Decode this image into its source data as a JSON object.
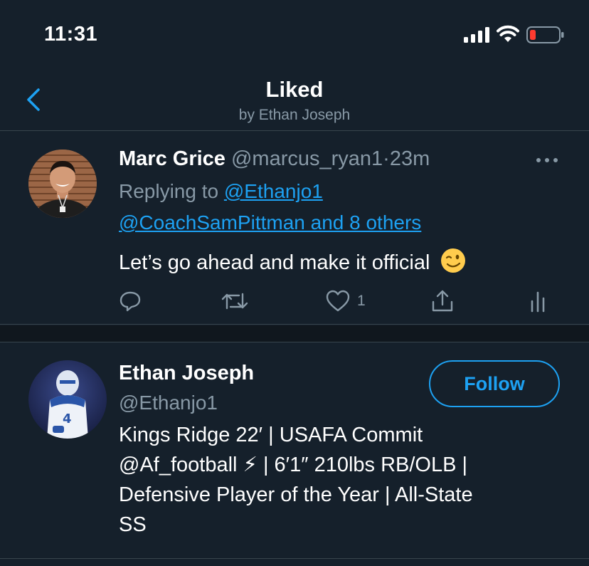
{
  "status_bar": {
    "time": "11:31",
    "battery_color": "#ff3b30"
  },
  "nav": {
    "title": "Liked",
    "subtitle": "by Ethan Joseph"
  },
  "tweet": {
    "author_name": "Marc Grice",
    "author_handle": "@marcus_ryan1",
    "separator": "·",
    "time": "23m",
    "replying_prefix": "Replying to ",
    "replying_to_1": "@Ethanjo1",
    "replying_to_2": "@CoachSamPittman and 8 others",
    "text": "Let’s go ahead and make it official",
    "emoji": "winking-face",
    "like_count": "1"
  },
  "user_card": {
    "name": "Ethan Joseph",
    "handle": "@Ethanjo1",
    "follow_label": "Follow",
    "bio_lines": [
      "Kings Ridge 22′ | USAFA Commit",
      "@Af_football ⚡ | 6′1″ 210lbs RB/OLB |",
      "Defensive Player of the Year | All-State",
      "SS"
    ]
  },
  "colors": {
    "background": "#15202b",
    "accent": "#1da1f2",
    "secondary_text": "#8899a6",
    "divider": "#38444d"
  }
}
